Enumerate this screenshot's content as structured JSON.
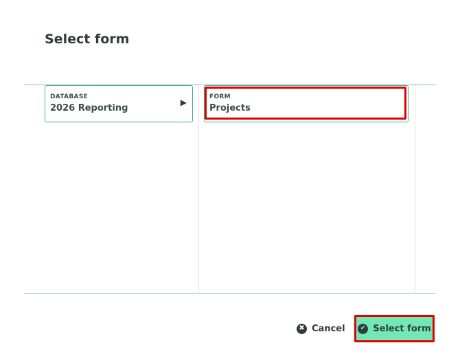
{
  "dialog": {
    "title": "Select form"
  },
  "columns": [
    {
      "kind": "DATABASE",
      "name": "2026 Reporting",
      "arrow_icon": "triangle-right-icon"
    },
    {
      "kind": "FORM",
      "name": "Projects"
    }
  ],
  "footer": {
    "cancel_label": "Cancel",
    "cancel_icon": "close-circle-icon",
    "select_label": "Select form",
    "select_icon": "check-circle-icon"
  },
  "colors": {
    "accent_border": "#3fae93",
    "primary_button": "#72e8b6",
    "highlight": "#e00000"
  }
}
